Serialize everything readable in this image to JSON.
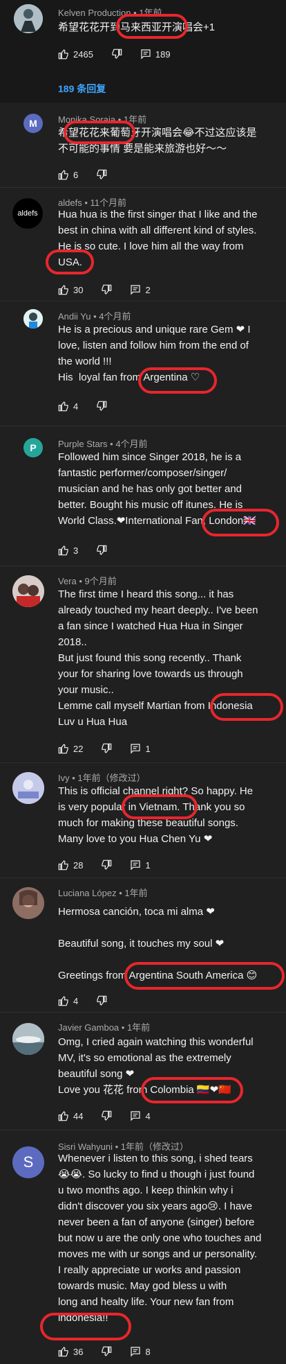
{
  "top_comment": {
    "author": "Kelven Production",
    "time": "1年前",
    "text": "希望花花开到马来西亚开演唱会+1",
    "likes": "2465",
    "replies": "189"
  },
  "replies_link": "189 条回复",
  "comments": [
    {
      "author": "Monika Soraia",
      "time": "1年前",
      "text": "希望花花来葡萄牙开演唱会😂不过这应该是\n不可能的事情 要是能来旅游也好～～",
      "likes": "6",
      "replies": "",
      "avatar_letter": "M",
      "avatar_color": "#5c6bc0"
    },
    {
      "author": "aldefs",
      "time": "11个月前",
      "text": "Hua hua is the first singer that I like and the\nbest in china with all different kind of styles.\nHe is so cute. I love him all the way from\nUSA.",
      "likes": "30",
      "replies": "2",
      "avatar_letter": "aldefs",
      "avatar_color": "#000000"
    },
    {
      "author": "Andii Yu",
      "time": "4个月前",
      "text": "He is a precious and unique rare Gem ❤ I\nlove, listen and follow him from the end of\nthe world !!!\nHis  loyal fan from Argentina ♡",
      "likes": "4",
      "replies": "",
      "avatar_letter": "",
      "avatar_color": "#cfd8dc"
    },
    {
      "author": "Purple Stars",
      "time": "4个月前",
      "text": "Followed him since Singer 2018, he is a\nfantastic performer/composer/singer/\nmusician and he has only got better and\nbetter. Bought his music off itunes. He is\nWorld Class.❤International Fan, London🇬🇧",
      "likes": "3",
      "replies": "",
      "avatar_letter": "P",
      "avatar_color": "#26a69a"
    },
    {
      "author": "Vera",
      "time": "9个月前",
      "text": "The first time I heard this song... it has\nalready touched my heart deeply.. I've been\na fan since I watched Hua Hua in Singer\n2018..\nBut just found this song recently.. Thank\nyour for sharing love towards us through\nyour music..\nLemme call myself Martian from Indonesia\nLuv u Hua Hua",
      "likes": "22",
      "replies": "1",
      "avatar_letter": "",
      "avatar_color": "#8d6e63"
    },
    {
      "author": "Ivy",
      "time": "1年前（修改过）",
      "text": "This is official channel right? So happy. He\nis very popular in Vietnam. Thank you so\nmuch for making these beautiful songs.\nMany love to you Hua Chen Yu ❤",
      "likes": "28",
      "replies": "1",
      "avatar_letter": "",
      "avatar_color": "#9fa8da"
    },
    {
      "author": "Luciana López",
      "time": "1年前",
      "text": "Hermosa canción, toca mi alma ❤\n\nBeautiful song, it touches my soul ❤\n\nGreetings from Argentina South America 😊",
      "likes": "4",
      "replies": "",
      "avatar_letter": "",
      "avatar_color": "#6d4c41"
    },
    {
      "author": "Javier Gamboa",
      "time": "1年前",
      "text": "Omg, I cried again watching this wonderful\nMV, it's so emotional as the extremely\nbeautiful song ❤\nLove you 花花 from Colombia 🇨🇴❤🇨🇳",
      "likes": "44",
      "replies": "4",
      "avatar_letter": "",
      "avatar_color": "#90a4ae"
    },
    {
      "author": "Sisri Wahyuni",
      "time": "1年前（修改过）",
      "text": "Whenever i listen to this song, i shed tears\n😭😭. So lucky to find u though i just found\nu two months ago. I keep thinkin why i\ndidn't discover you six years ago😢. I have\nnever been a fan of anyone (singer) before\nbut now u are the only one who touches and\nmoves me with ur songs and ur personality.\nI really appreciate ur works and passion\ntowards music. May god bless u with\nlong and healty life. Your new fan from\nindonesia!!",
      "likes": "36",
      "replies": "8",
      "avatar_letter": "S",
      "avatar_color": "#5c6bc0"
    }
  ]
}
